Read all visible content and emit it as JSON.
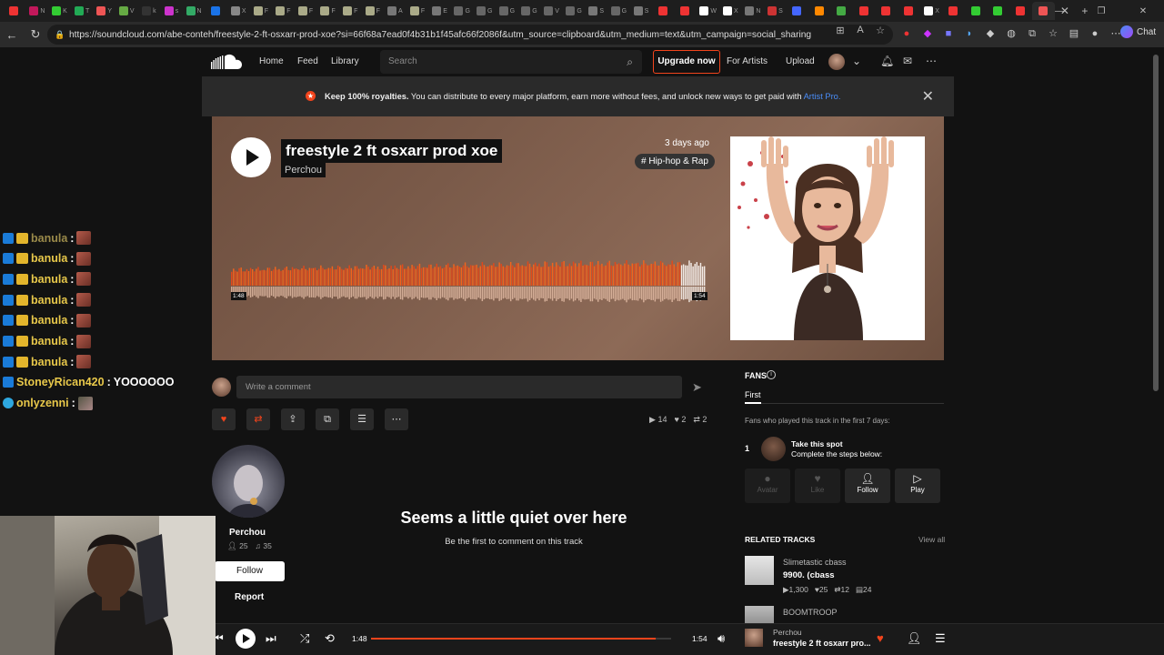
{
  "browser": {
    "url": "https://soundcloud.com/abe-conteh/freestyle-2-ft-osxarr-prod-xoe?si=66f68a7ead0f4b31b1f45afc66f2086f&utm_source=clipboard&utm_medium=text&utm_campaign=social_sharing",
    "chat_label": "Chat",
    "tab_letters": [
      "",
      "N",
      "K",
      "T",
      "Y",
      "V",
      "k",
      "s",
      "N",
      "",
      "X",
      "F",
      "F",
      "F",
      "F",
      "F",
      "F",
      "A",
      "F",
      "E",
      "G",
      "G",
      "G",
      "G",
      "V",
      "G",
      "S",
      "G",
      "S",
      "",
      "",
      "W",
      "X",
      "N",
      "S",
      "",
      "",
      "",
      "",
      "",
      "",
      "X",
      "",
      "",
      "",
      "",
      ""
    ]
  },
  "header": {
    "home": "Home",
    "feed": "Feed",
    "library": "Library",
    "search_placeholder": "Search",
    "upgrade": "Upgrade now",
    "for_artists": "For Artists",
    "upload": "Upload"
  },
  "banner": {
    "bold": "Keep 100% royalties.",
    "text": " You can distribute to every major platform, earn more without fees, and unlock new ways to get paid with ",
    "link": "Artist Pro."
  },
  "track": {
    "title": "freestyle 2 ft osxarr prod xoe",
    "artist": "Perchou",
    "date": "3 days ago",
    "genre": "# Hip-hop & Rap",
    "wave_elapsed": "1:48",
    "wave_total": "1:54",
    "progress": 0.947
  },
  "comment": {
    "placeholder": "Write a comment"
  },
  "stats": {
    "plays": "14",
    "likes": "2",
    "reposts": "2"
  },
  "artist_card": {
    "name": "Perchou",
    "followers": "25",
    "tracks": "35",
    "follow": "Follow",
    "report": "Report"
  },
  "empty_comments": {
    "title": "Seems a little quiet over here",
    "subtitle": "Be the first to comment on this track"
  },
  "fans": {
    "heading": "FANS",
    "tab": "First",
    "description": "Fans who played this track in the first 7 days:",
    "rank": "1",
    "spot_title": "Take this spot",
    "spot_sub": "Complete the steps below:",
    "steps": [
      "Avatar",
      "Like",
      "Follow",
      "Play"
    ]
  },
  "related": {
    "heading": "RELATED TRACKS",
    "view_all": "View all",
    "items": [
      {
        "user": "Slimetastic cbass",
        "title": "9900. (cbass",
        "plays": "1,300",
        "likes": "25",
        "reposts": "12",
        "comments": "24"
      },
      {
        "user": "BOOMTROOP"
      }
    ]
  },
  "player": {
    "elapsed": "1:48",
    "total": "1:54",
    "artist": "Perchou",
    "title": "freestyle 2 ft osxarr pro...",
    "progress": 0.947
  },
  "stream_chat": [
    {
      "user": "banula",
      "msg": ""
    },
    {
      "user": "banula",
      "msg": ""
    },
    {
      "user": "banula",
      "msg": ""
    },
    {
      "user": "banula",
      "msg": ""
    },
    {
      "user": "banula",
      "msg": ""
    },
    {
      "user": "banula",
      "msg": ""
    },
    {
      "user": "banula",
      "msg": ""
    },
    {
      "user": "StoneyRican420",
      "msg": "YOOOOOO"
    },
    {
      "user": "onlyzenni",
      "msg": ""
    }
  ],
  "colors": {
    "accent": "#f2441c",
    "chat_user": "#e8c84a",
    "link": "#4a8df8"
  }
}
